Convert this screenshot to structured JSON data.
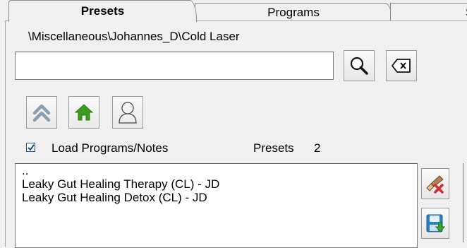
{
  "tabs": [
    {
      "label": "Presets",
      "active": true
    },
    {
      "label": "Programs",
      "active": false
    },
    {
      "label": "S",
      "active": false
    }
  ],
  "path": "\\Miscellaneous\\Johannes_D\\Cold Laser",
  "search": {
    "value": "",
    "placeholder": ""
  },
  "buttons": {
    "search": "search-icon",
    "clear": "backspace-clear-icon",
    "up": "double-chevron-up-icon",
    "home": "home-icon",
    "user": "user-icon",
    "delete": "eraser-delete-icon",
    "save": "save-icon"
  },
  "options": {
    "load_programs_notes_label": "Load Programs/Notes",
    "load_programs_notes_checked": true
  },
  "presets": {
    "label": "Presets",
    "count": "2",
    "items": [
      "..",
      "Leaky Gut Healing  Therapy (CL) - JD",
      "Leaky Gut Healing Detox (CL) - JD"
    ]
  },
  "colors": {
    "home_green": "#3c9a1e",
    "up_arrow": "#8aa0b0",
    "checkbox_border": "#1c5180",
    "save_blue": "#2a7fc0",
    "save_green": "#3aa82a",
    "delete_red": "#d02a2a"
  }
}
